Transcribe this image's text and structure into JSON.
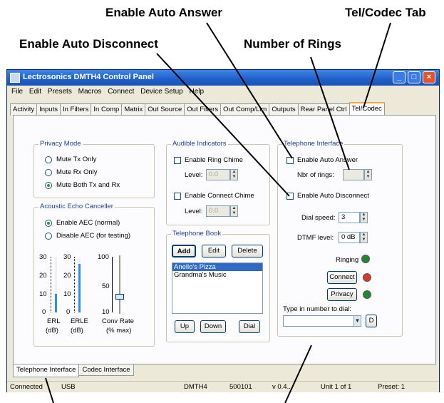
{
  "callouts": {
    "auto_answer": "Enable Auto Answer",
    "tel_codec_tab": "Tel/Codec Tab",
    "auto_disconnect": "Enable Auto Disconnect",
    "rings": "Number of Rings"
  },
  "window": {
    "title": "Lectrosonics DMTH4 Control Panel",
    "controls": {
      "minimize": "_",
      "maximize": "□",
      "close": "×"
    }
  },
  "menu": [
    "File",
    "Edit",
    "Presets",
    "Macros",
    "Connect",
    "Device Setup",
    "Help"
  ],
  "tabs": [
    "Activity",
    "Inputs",
    "In Filters",
    "In Comp",
    "Matrix",
    "Out Source",
    "Out Filters",
    "Out Comp/Lim",
    "Outputs",
    "Rear Panel Ctrl",
    "Tel/Codec"
  ],
  "privacy": {
    "title": "Privacy Mode",
    "options": [
      "Mute Tx Only",
      "Mute Rx Only",
      "Mute Both Tx and Rx"
    ],
    "selected": 2
  },
  "aec": {
    "title": "Acoustic Echo Canceller",
    "options": [
      "Enable AEC (normal)",
      "Disable AEC (for testing)"
    ],
    "selected": 0,
    "erl_ticks": [
      "30",
      "20",
      "10",
      "0"
    ],
    "erle_ticks": [
      "30",
      "20",
      "10",
      "0"
    ],
    "conv_ticks": [
      "100",
      "50",
      "10"
    ],
    "erl_label": "ERL",
    "erle_label": "ERLE",
    "conv_label": "Conv Rate",
    "erl_unit": "(dB)",
    "erle_unit": "(dB)",
    "conv_unit": "(% max)",
    "erl_level": 10,
    "erle_level": 26,
    "accent": "#2f8fe8"
  },
  "audible": {
    "title": "Audible Indicators",
    "ring_chime": "Enable Ring Chime",
    "connect_chime": "Enable Connect Chime",
    "level_label": "Level:",
    "level_label2": "Level:",
    "ring_level": "0.0",
    "connect_level": "0.0"
  },
  "phonebook": {
    "title": "Telephone Book",
    "add": "Add",
    "edit": "Edit",
    "delete": "Delete",
    "entries": [
      "Anello's Pizza",
      "Grandma's Music"
    ],
    "selected": 0,
    "up": "Up",
    "down": "Down",
    "dial": "Dial"
  },
  "telephone": {
    "title": "Telephone Interface",
    "auto_answer": "Enable Auto Answer",
    "nbr_rings_label": "Nbr of rings:",
    "auto_disconnect": "Enable Auto Disconnect",
    "dial_speed_label": "Dial speed:",
    "dial_speed": "3",
    "dtmf_label": "DTMF level:",
    "dtmf": "0 dB",
    "ringing": "Ringing",
    "connect": "Connect",
    "privacy": "Privacy",
    "type_label": "Type in number to dial:",
    "d_button": "D",
    "led_colors": {
      "ringing": "#1e8a2e",
      "connect": "#d63a2a",
      "privacy": "#1e8a2e"
    }
  },
  "bottom_tabs": [
    "Telephone Interface",
    "Codec Interface"
  ],
  "status": {
    "connection": "Connected",
    "port": "USB",
    "device": "DMTH4",
    "serial": "500101",
    "version": "v 0.4...",
    "unit": "Unit 1 of 1",
    "preset": "Preset: 1"
  }
}
